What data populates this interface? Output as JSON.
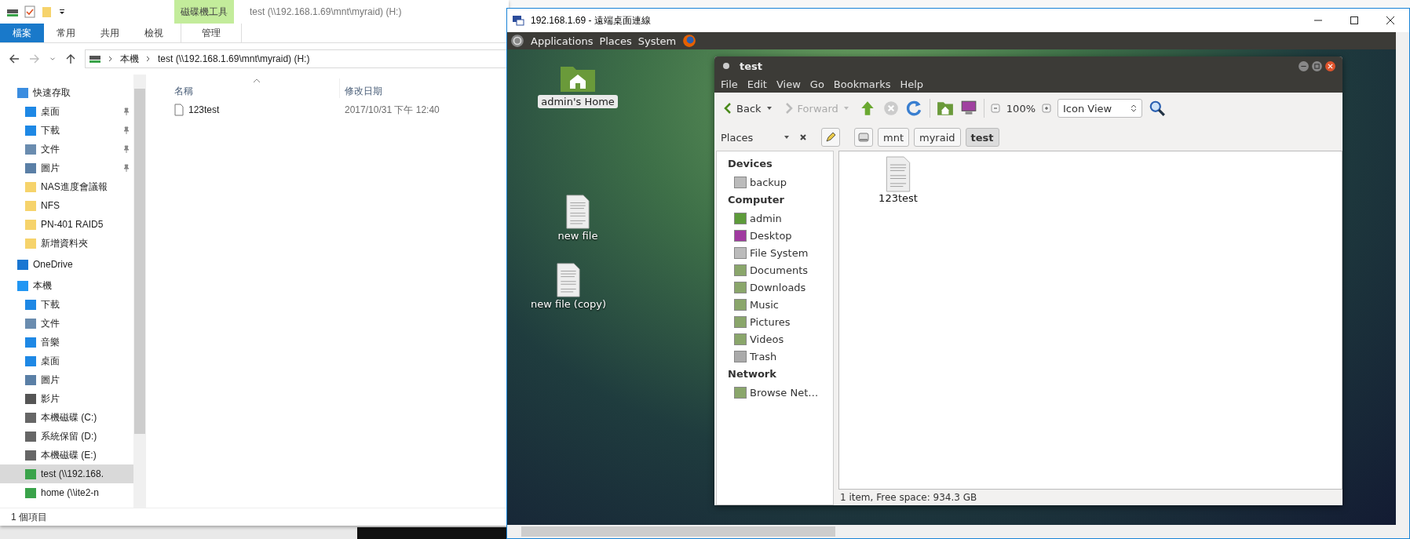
{
  "explorer": {
    "title": "test (\\\\192.168.1.69\\mnt\\myraid) (H:)",
    "ribbon_context_group": "磁碟機工具",
    "ribbon_tabs": [
      {
        "label": "檔案",
        "kind": "file"
      },
      {
        "label": "常用",
        "kind": "normal"
      },
      {
        "label": "共用",
        "kind": "normal"
      },
      {
        "label": "檢視",
        "kind": "normal"
      },
      {
        "label": "管理",
        "kind": "contextual"
      }
    ],
    "address_path": [
      "本機",
      "test (\\\\192.168.1.69\\mnt\\myraid) (H:)"
    ],
    "nav_pane": [
      {
        "label": "快速存取",
        "kind": "star",
        "selected": false,
        "children": [
          {
            "label": "桌面",
            "kind": "desktop",
            "selected": false,
            "pinned": true
          },
          {
            "label": "下載",
            "kind": "download",
            "selected": false,
            "pinned": true
          },
          {
            "label": "文件",
            "kind": "document",
            "selected": false,
            "pinned": true
          },
          {
            "label": "圖片",
            "kind": "picture",
            "selected": false,
            "pinned": true
          },
          {
            "label": "NAS進度會議報",
            "kind": "folder",
            "selected": false,
            "pinned": false
          },
          {
            "label": "NFS",
            "kind": "folder",
            "selected": false,
            "pinned": false
          },
          {
            "label": "PN-401 RAID5",
            "kind": "folder",
            "selected": false,
            "pinned": false
          },
          {
            "label": "新增資料夾",
            "kind": "folder",
            "selected": false,
            "pinned": false
          }
        ]
      },
      {
        "label": "OneDrive",
        "kind": "cloud",
        "selected": false
      },
      {
        "label": "本機",
        "kind": "computer",
        "selected": false,
        "children": [
          {
            "label": "下載",
            "kind": "download",
            "selected": false
          },
          {
            "label": "文件",
            "kind": "document",
            "selected": false
          },
          {
            "label": "音樂",
            "kind": "music",
            "selected": false
          },
          {
            "label": "桌面",
            "kind": "desktop",
            "selected": false
          },
          {
            "label": "圖片",
            "kind": "picture",
            "selected": false
          },
          {
            "label": "影片",
            "kind": "video",
            "selected": false
          },
          {
            "label": "本機磁碟 (C:)",
            "kind": "system-drive",
            "selected": false
          },
          {
            "label": "系統保留 (D:)",
            "kind": "drive",
            "selected": false
          },
          {
            "label": "本機磁碟 (E:)",
            "kind": "drive",
            "selected": false
          },
          {
            "label": "test (\\\\192.168.",
            "kind": "network-drive",
            "selected": true
          },
          {
            "label": "home (\\\\ite2-n",
            "kind": "network-drive",
            "selected": false
          }
        ]
      }
    ],
    "columns": [
      {
        "label": "名稱",
        "sorted": true
      },
      {
        "label": "修改日期",
        "sorted": false
      }
    ],
    "files": [
      {
        "name": "123test",
        "modified": "2017/10/31 下午 12:40"
      }
    ],
    "status": "1 個項目"
  },
  "remote_window": {
    "title": "192.168.1.69 - 遠端桌面連線",
    "panel_menus": [
      "Applications",
      "Places",
      "System"
    ],
    "desktop_icons": [
      {
        "label": "admin's Home",
        "kind": "home",
        "selected": true
      },
      {
        "label": "new file",
        "kind": "file",
        "selected": false
      },
      {
        "label": "new file (copy)",
        "kind": "file",
        "selected": false
      }
    ],
    "file_manager": {
      "title": "test",
      "menus": [
        "File",
        "Edit",
        "View",
        "Go",
        "Bookmarks",
        "Help"
      ],
      "nav_buttons": [
        {
          "label": "Back",
          "disabled": false
        },
        {
          "label": "Forward",
          "disabled": true
        }
      ],
      "zoom": "100%",
      "view_mode": "Icon View",
      "sidebar_selector": "Places",
      "path_buttons": [
        {
          "label": "mnt",
          "selected": false
        },
        {
          "label": "myraid",
          "selected": false
        },
        {
          "label": "test",
          "selected": true
        }
      ],
      "sidebar_sections": [
        {
          "heading": "Devices",
          "items": [
            {
              "label": "backup",
              "kind": "drive"
            }
          ]
        },
        {
          "heading": "Computer",
          "items": [
            {
              "label": "admin",
              "kind": "home"
            },
            {
              "label": "Desktop",
              "kind": "desktop"
            },
            {
              "label": "File System",
              "kind": "drive"
            },
            {
              "label": "Documents",
              "kind": "folder"
            },
            {
              "label": "Downloads",
              "kind": "folder"
            },
            {
              "label": "Music",
              "kind": "folder"
            },
            {
              "label": "Pictures",
              "kind": "folder"
            },
            {
              "label": "Videos",
              "kind": "folder"
            },
            {
              "label": "Trash",
              "kind": "trash"
            }
          ]
        },
        {
          "heading": "Network",
          "items": [
            {
              "label": "Browse Net…",
              "kind": "folder"
            }
          ]
        }
      ],
      "items": [
        {
          "name": "123test"
        }
      ],
      "status": "1 item, Free space: 934.3 GB"
    }
  }
}
